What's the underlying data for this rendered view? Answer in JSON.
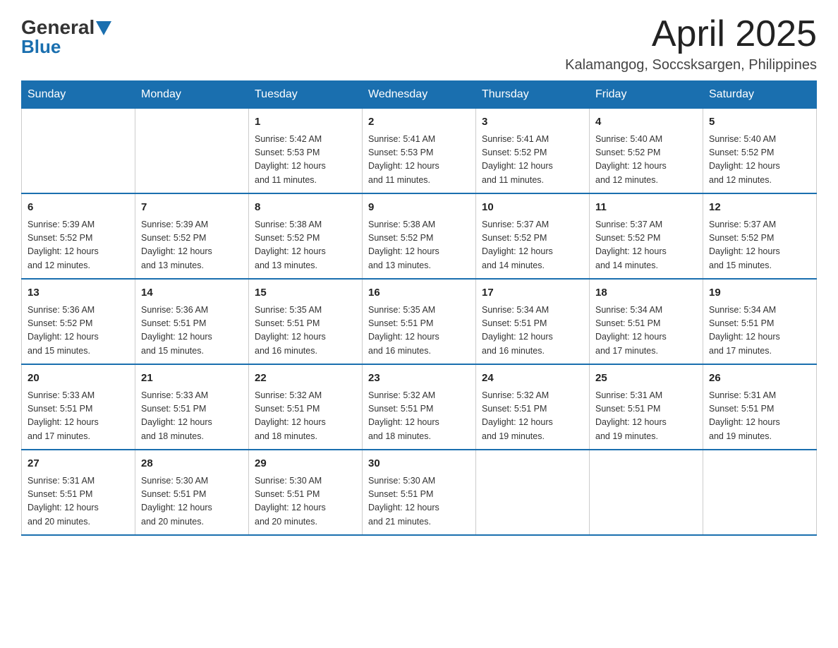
{
  "header": {
    "logo_general": "General",
    "logo_blue": "Blue",
    "month_year": "April 2025",
    "location": "Kalamangog, Soccsksargen, Philippines"
  },
  "calendar": {
    "days": [
      "Sunday",
      "Monday",
      "Tuesday",
      "Wednesday",
      "Thursday",
      "Friday",
      "Saturday"
    ],
    "weeks": [
      [
        {
          "day": "",
          "info": ""
        },
        {
          "day": "",
          "info": ""
        },
        {
          "day": "1",
          "info": "Sunrise: 5:42 AM\nSunset: 5:53 PM\nDaylight: 12 hours\nand 11 minutes."
        },
        {
          "day": "2",
          "info": "Sunrise: 5:41 AM\nSunset: 5:53 PM\nDaylight: 12 hours\nand 11 minutes."
        },
        {
          "day": "3",
          "info": "Sunrise: 5:41 AM\nSunset: 5:52 PM\nDaylight: 12 hours\nand 11 minutes."
        },
        {
          "day": "4",
          "info": "Sunrise: 5:40 AM\nSunset: 5:52 PM\nDaylight: 12 hours\nand 12 minutes."
        },
        {
          "day": "5",
          "info": "Sunrise: 5:40 AM\nSunset: 5:52 PM\nDaylight: 12 hours\nand 12 minutes."
        }
      ],
      [
        {
          "day": "6",
          "info": "Sunrise: 5:39 AM\nSunset: 5:52 PM\nDaylight: 12 hours\nand 12 minutes."
        },
        {
          "day": "7",
          "info": "Sunrise: 5:39 AM\nSunset: 5:52 PM\nDaylight: 12 hours\nand 13 minutes."
        },
        {
          "day": "8",
          "info": "Sunrise: 5:38 AM\nSunset: 5:52 PM\nDaylight: 12 hours\nand 13 minutes."
        },
        {
          "day": "9",
          "info": "Sunrise: 5:38 AM\nSunset: 5:52 PM\nDaylight: 12 hours\nand 13 minutes."
        },
        {
          "day": "10",
          "info": "Sunrise: 5:37 AM\nSunset: 5:52 PM\nDaylight: 12 hours\nand 14 minutes."
        },
        {
          "day": "11",
          "info": "Sunrise: 5:37 AM\nSunset: 5:52 PM\nDaylight: 12 hours\nand 14 minutes."
        },
        {
          "day": "12",
          "info": "Sunrise: 5:37 AM\nSunset: 5:52 PM\nDaylight: 12 hours\nand 15 minutes."
        }
      ],
      [
        {
          "day": "13",
          "info": "Sunrise: 5:36 AM\nSunset: 5:52 PM\nDaylight: 12 hours\nand 15 minutes."
        },
        {
          "day": "14",
          "info": "Sunrise: 5:36 AM\nSunset: 5:51 PM\nDaylight: 12 hours\nand 15 minutes."
        },
        {
          "day": "15",
          "info": "Sunrise: 5:35 AM\nSunset: 5:51 PM\nDaylight: 12 hours\nand 16 minutes."
        },
        {
          "day": "16",
          "info": "Sunrise: 5:35 AM\nSunset: 5:51 PM\nDaylight: 12 hours\nand 16 minutes."
        },
        {
          "day": "17",
          "info": "Sunrise: 5:34 AM\nSunset: 5:51 PM\nDaylight: 12 hours\nand 16 minutes."
        },
        {
          "day": "18",
          "info": "Sunrise: 5:34 AM\nSunset: 5:51 PM\nDaylight: 12 hours\nand 17 minutes."
        },
        {
          "day": "19",
          "info": "Sunrise: 5:34 AM\nSunset: 5:51 PM\nDaylight: 12 hours\nand 17 minutes."
        }
      ],
      [
        {
          "day": "20",
          "info": "Sunrise: 5:33 AM\nSunset: 5:51 PM\nDaylight: 12 hours\nand 17 minutes."
        },
        {
          "day": "21",
          "info": "Sunrise: 5:33 AM\nSunset: 5:51 PM\nDaylight: 12 hours\nand 18 minutes."
        },
        {
          "day": "22",
          "info": "Sunrise: 5:32 AM\nSunset: 5:51 PM\nDaylight: 12 hours\nand 18 minutes."
        },
        {
          "day": "23",
          "info": "Sunrise: 5:32 AM\nSunset: 5:51 PM\nDaylight: 12 hours\nand 18 minutes."
        },
        {
          "day": "24",
          "info": "Sunrise: 5:32 AM\nSunset: 5:51 PM\nDaylight: 12 hours\nand 19 minutes."
        },
        {
          "day": "25",
          "info": "Sunrise: 5:31 AM\nSunset: 5:51 PM\nDaylight: 12 hours\nand 19 minutes."
        },
        {
          "day": "26",
          "info": "Sunrise: 5:31 AM\nSunset: 5:51 PM\nDaylight: 12 hours\nand 19 minutes."
        }
      ],
      [
        {
          "day": "27",
          "info": "Sunrise: 5:31 AM\nSunset: 5:51 PM\nDaylight: 12 hours\nand 20 minutes."
        },
        {
          "day": "28",
          "info": "Sunrise: 5:30 AM\nSunset: 5:51 PM\nDaylight: 12 hours\nand 20 minutes."
        },
        {
          "day": "29",
          "info": "Sunrise: 5:30 AM\nSunset: 5:51 PM\nDaylight: 12 hours\nand 20 minutes."
        },
        {
          "day": "30",
          "info": "Sunrise: 5:30 AM\nSunset: 5:51 PM\nDaylight: 12 hours\nand 21 minutes."
        },
        {
          "day": "",
          "info": ""
        },
        {
          "day": "",
          "info": ""
        },
        {
          "day": "",
          "info": ""
        }
      ]
    ]
  }
}
